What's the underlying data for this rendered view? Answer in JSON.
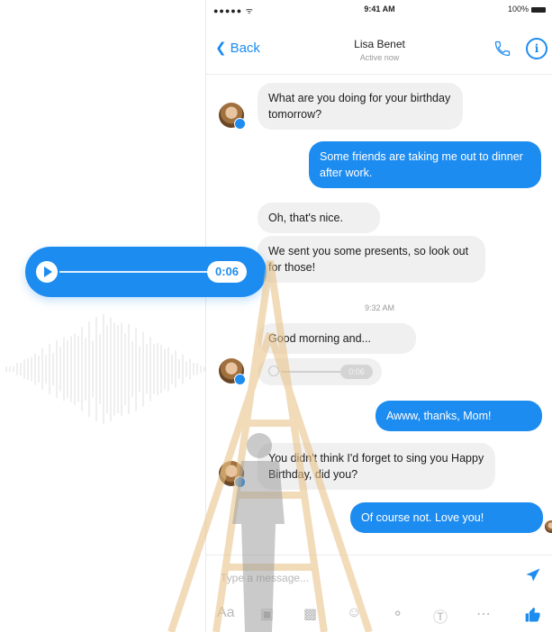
{
  "status_bar": {
    "signal": "●●●●● ᯤ",
    "time": "9:41 AM",
    "battery": "100%"
  },
  "nav": {
    "back_label": "Back",
    "contact_name": "Lisa Benet",
    "presence": "Active now"
  },
  "messages": [
    {
      "side": "in",
      "text": "What are you doing for your birthday tomorrow?"
    },
    {
      "side": "out",
      "text": "Some friends are taking me out to dinner after work."
    },
    {
      "side": "in",
      "text": "Oh, that's nice."
    },
    {
      "side": "in",
      "text": "We sent you some presents, so look out for those!"
    },
    {
      "side": "in",
      "text": "Good morning and..."
    },
    {
      "side": "out",
      "text": "Awww, thanks, Mom!"
    },
    {
      "side": "in",
      "text": "You didn't think I'd forget to sing you Happy Birthday, did you?"
    },
    {
      "side": "out",
      "text": "Of course not. Love you!"
    }
  ],
  "timestamp": "9:32 AM",
  "voice_message": {
    "duration": "0:06"
  },
  "composer": {
    "placeholder": "Type a message..."
  },
  "toolbar": {
    "aa_label": "Aa"
  },
  "colors": {
    "accent": "#1d8cf0",
    "incoming_bubble": "#f1f0f0"
  },
  "icons": [
    "phone-icon",
    "info-icon",
    "send-icon",
    "camera-icon",
    "photo-icon",
    "emoji-icon",
    "microphone-icon",
    "payment-icon",
    "more-icon",
    "like-icon",
    "play-icon",
    "waveform-icon"
  ]
}
